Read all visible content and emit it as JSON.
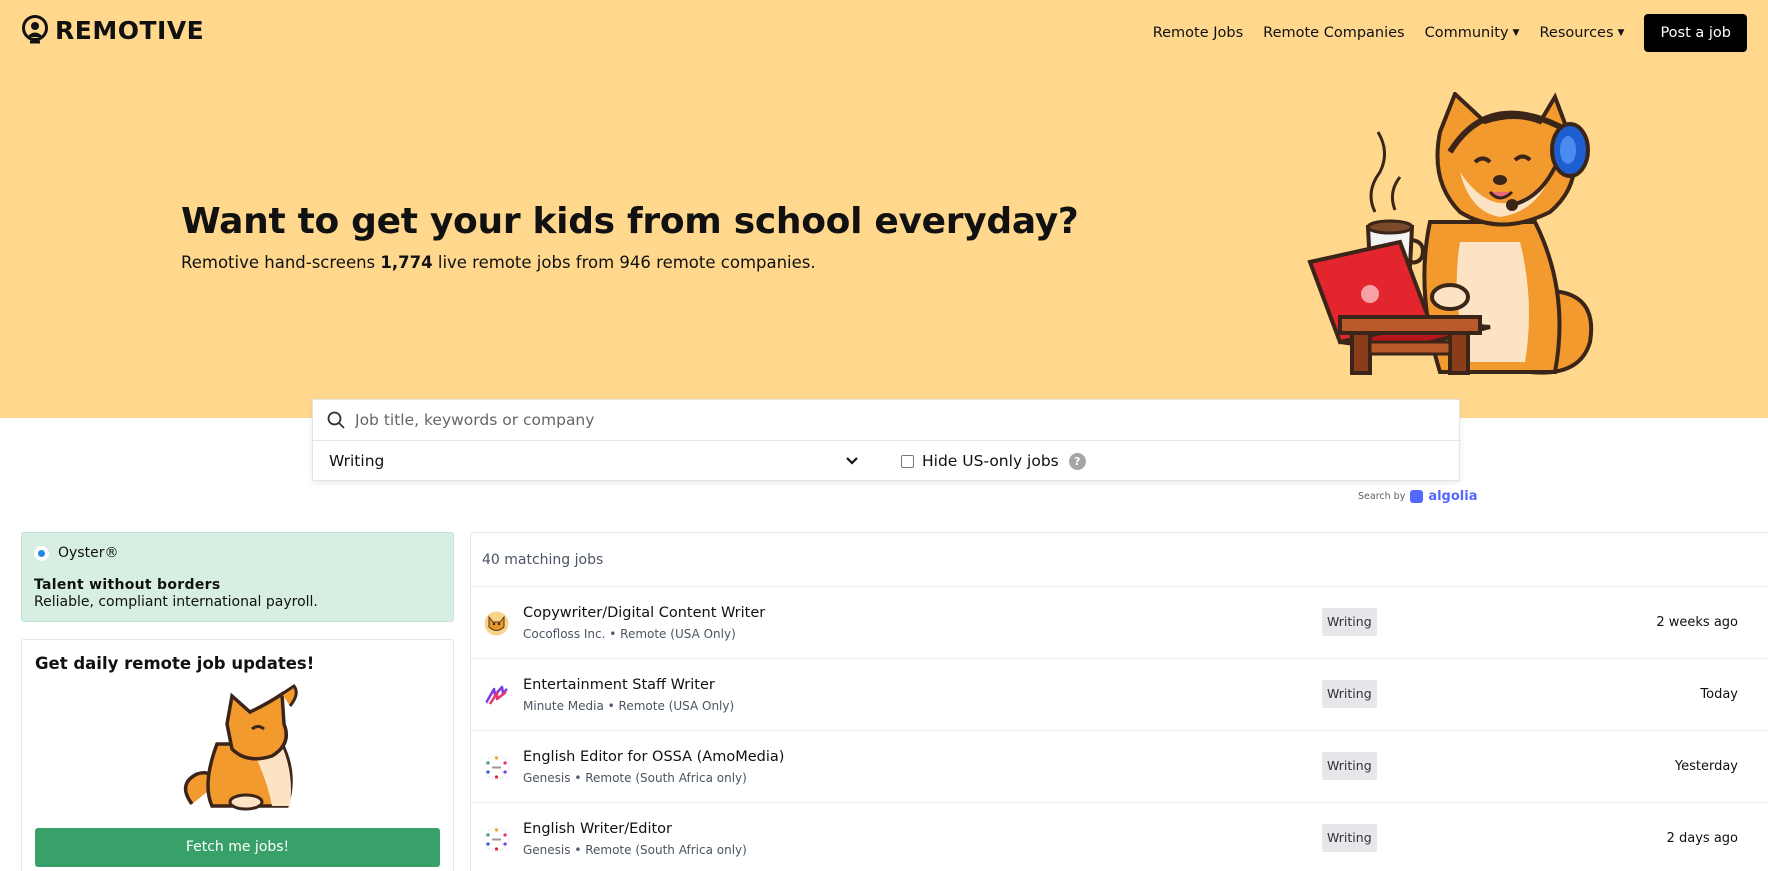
{
  "brand": {
    "name": "REMOTIVE"
  },
  "nav": {
    "remote_jobs": "Remote Jobs",
    "remote_companies": "Remote Companies",
    "community": "Community",
    "resources": "Resources",
    "post_job": "Post a job"
  },
  "hero": {
    "title": "Want to get your kids from school everyday?",
    "sub_prefix": "Remotive hand-screens ",
    "job_count": "1,774",
    "sub_suffix": " live remote jobs from 946 remote companies."
  },
  "search": {
    "placeholder": "Job title, keywords or company",
    "category": "Writing",
    "hide_us_label": "Hide US-only jobs",
    "hide_us_checked": false,
    "help": "?",
    "search_by": "Search by",
    "provider": "algolia"
  },
  "ad": {
    "brand": "Oyster®",
    "headline": "Talent without borders",
    "text": "Reliable, compliant international payroll."
  },
  "updates": {
    "title": "Get daily remote job updates!",
    "button": "Fetch me jobs!"
  },
  "jobs": {
    "count_label": "40 matching jobs",
    "items": [
      {
        "title": "Copywriter/Digital Content Writer",
        "company": "Cocofloss Inc.",
        "location": "Remote (USA Only)",
        "meta": "Cocofloss Inc. • Remote (USA Only)",
        "tag": "Writing",
        "date": "2 weeks ago"
      },
      {
        "title": "Entertainment Staff Writer",
        "company": "Minute Media",
        "location": "Remote (USA Only)",
        "meta": "Minute Media • Remote (USA Only)",
        "tag": "Writing",
        "date": "Today"
      },
      {
        "title": "English Editor for OSSA (AmoMedia)",
        "company": "Genesis",
        "location": "Remote (South Africa only)",
        "meta": "Genesis • Remote (South Africa only)",
        "tag": "Writing",
        "date": "Yesterday"
      },
      {
        "title": "English Writer/Editor",
        "company": "Genesis",
        "location": "Remote (South Africa only)",
        "meta": "Genesis • Remote (South Africa only)",
        "tag": "Writing",
        "date": "2 days ago"
      }
    ]
  },
  "colors": {
    "hero_bg": "#ffd88e",
    "ad_bg": "#d7eee3",
    "button_green": "#38a169",
    "post_btn": "#000000",
    "algolia": "#5468ff"
  },
  "icons": [
    "logo-icon",
    "search-icon",
    "chevron-down-icon",
    "help-icon",
    "oyster-logo-icon",
    "algolia-icon"
  ]
}
